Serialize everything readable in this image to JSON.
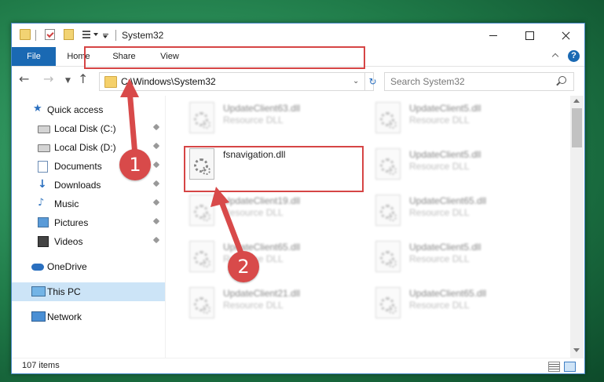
{
  "window": {
    "title": "System32",
    "controls": {
      "minimize": "minimize-button",
      "maximize": "maximize-button",
      "close": "close-button"
    }
  },
  "ribbon": {
    "tabs": [
      {
        "label": "File"
      },
      {
        "label": "Home"
      },
      {
        "label": "Share"
      },
      {
        "label": "View"
      }
    ],
    "help_label": "?"
  },
  "address": {
    "path": "C:\\Windows\\System32",
    "search_placeholder": "Search System32"
  },
  "sidebar": {
    "items": [
      {
        "label": "Quick access",
        "icon": "star-icon",
        "pinned": false
      },
      {
        "label": "Local Disk (C:)",
        "icon": "drive-icon",
        "pinned": true
      },
      {
        "label": "Local Disk (D:)",
        "icon": "drive-icon",
        "pinned": true
      },
      {
        "label": "Documents",
        "icon": "documents-icon",
        "pinned": true
      },
      {
        "label": "Downloads",
        "icon": "downloads-icon",
        "pinned": true
      },
      {
        "label": "Music",
        "icon": "music-icon",
        "pinned": true
      },
      {
        "label": "Pictures",
        "icon": "pictures-icon",
        "pinned": true
      },
      {
        "label": "Videos",
        "icon": "videos-icon",
        "pinned": true
      },
      {
        "label": "OneDrive",
        "icon": "cloud-icon",
        "pinned": false
      },
      {
        "label": "This PC",
        "icon": "computer-icon",
        "pinned": false,
        "selected": true
      },
      {
        "label": "Network",
        "icon": "network-icon",
        "pinned": false
      }
    ]
  },
  "files": [
    {
      "name": "UpdateClient63.dll",
      "type": "Resource DLL",
      "blurred": true
    },
    {
      "name": "UpdateClient5.dll",
      "type": "Resource DLL",
      "blurred": true
    },
    {
      "name": "fsnavigation.dll",
      "type": "",
      "blurred": false,
      "highlighted": true
    },
    {
      "name": "UpdateClient5.dll",
      "type": "Resource DLL",
      "blurred": true
    },
    {
      "name": "UpdateClient19.dll",
      "type": "Resource DLL",
      "blurred": true
    },
    {
      "name": "UpdateClient65.dll",
      "type": "Resource DLL",
      "blurred": true
    },
    {
      "name": "UpdateClient65.dll",
      "type": "Resource DLL",
      "blurred": true
    },
    {
      "name": "UpdateClient5.dll",
      "type": "Resource DLL",
      "blurred": true
    },
    {
      "name": "UpdateClient21.dll",
      "type": "Resource DLL",
      "blurred": true
    },
    {
      "name": "UpdateClient65.dll",
      "type": "Resource DLL",
      "blurred": true
    }
  ],
  "status": {
    "item_count": "107 items"
  },
  "annotations": {
    "step1": "1",
    "step2": "2",
    "color": "#d84a4a"
  },
  "colors": {
    "accent": "#1a69b3",
    "selection": "#cce4f7",
    "highlight_border": "#d64545"
  }
}
